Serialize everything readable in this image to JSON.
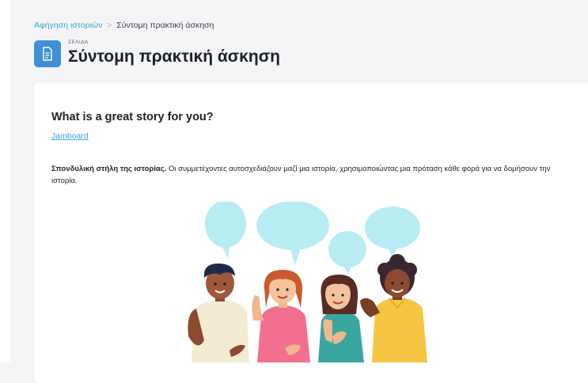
{
  "breadcrumb": {
    "parent": "Αφήγηση ιστοριών",
    "separator": ">",
    "current": "Σύντομη πρακτική άσκηση"
  },
  "page": {
    "kicker": "ΣΕΛΙΔΑ",
    "title": "Σύντομη πρακτική άσκηση",
    "icon": "document-icon"
  },
  "content": {
    "heading": "What is a great story for you?",
    "link_label": "Jamboard",
    "description_bold": "Σπονδυλική στήλη της ιστορίας.",
    "description_text": " Οι συμμετέχοντες αυτοσχεδιάζουν μαζί μια ιστορία, χρησιμοποιώντας μια πρόταση κάθε φορά για να δομήσουν την ιστορία."
  },
  "colors": {
    "accent": "#3aa6d6",
    "page_icon_bg": "#3f8fd8",
    "bubble": "#b7ecf3"
  }
}
